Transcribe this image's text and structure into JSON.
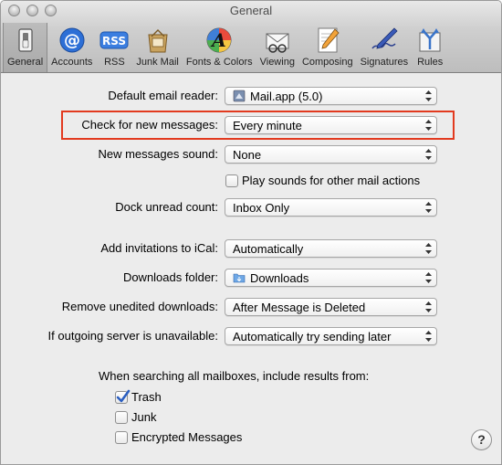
{
  "window": {
    "title": "General"
  },
  "toolbar": {
    "items": [
      {
        "label": "General",
        "icon": "switch-icon",
        "selected": true
      },
      {
        "label": "Accounts",
        "icon": "at-sign-icon"
      },
      {
        "label": "RSS",
        "icon": "rss-icon"
      },
      {
        "label": "Junk Mail",
        "icon": "junk-mail-icon"
      },
      {
        "label": "Fonts & Colors",
        "icon": "fonts-colors-icon"
      },
      {
        "label": "Viewing",
        "icon": "viewing-icon"
      },
      {
        "label": "Composing",
        "icon": "composing-icon"
      },
      {
        "label": "Signatures",
        "icon": "signatures-icon"
      },
      {
        "label": "Rules",
        "icon": "rules-icon"
      }
    ]
  },
  "settings": {
    "default_email_reader": {
      "label": "Default email reader:",
      "value": "Mail.app (5.0)"
    },
    "check_new_messages": {
      "label": "Check for new messages:",
      "value": "Every minute"
    },
    "new_messages_sound": {
      "label": "New messages sound:",
      "value": "None"
    },
    "play_sounds": {
      "label": "Play sounds for other mail actions",
      "checked": false
    },
    "dock_unread_count": {
      "label": "Dock unread count:",
      "value": "Inbox Only"
    },
    "add_invitations": {
      "label": "Add invitations to iCal:",
      "value": "Automatically"
    },
    "downloads_folder": {
      "label": "Downloads folder:",
      "value": "Downloads"
    },
    "remove_unedited": {
      "label": "Remove unedited downloads:",
      "value": "After Message is Deleted"
    },
    "outgoing_server": {
      "label": "If outgoing server is unavailable:",
      "value": "Automatically try sending later"
    }
  },
  "search": {
    "heading": "When searching all mailboxes, include results from:",
    "trash": {
      "label": "Trash",
      "checked": true
    },
    "junk": {
      "label": "Junk",
      "checked": false
    },
    "encrypted": {
      "label": "Encrypted Messages",
      "checked": false
    }
  },
  "help": {
    "label": "?"
  },
  "colors": {
    "highlight": "#e23a1f",
    "checkmark": "#2b5fc1"
  }
}
